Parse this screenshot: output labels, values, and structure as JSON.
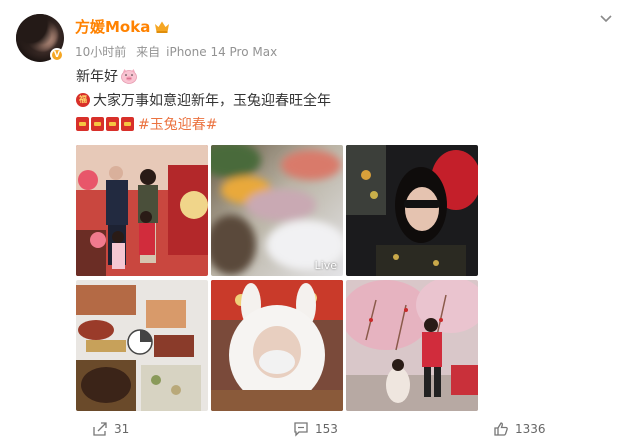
{
  "post": {
    "username": "方媛Moka",
    "time": "10小时前",
    "source_prefix": "来自",
    "source_device": "iPhone 14 Pro Max",
    "line1": "新年好",
    "line2": "大家万事如意迎新年，玉兔迎春旺全年",
    "hashtag": "#玉兔迎春#",
    "fu_char": "福",
    "images": [
      {
        "desc": "family-photo"
      },
      {
        "desc": "blurred-live",
        "badge": "Live"
      },
      {
        "desc": "car-selfie"
      },
      {
        "desc": "banquet-food"
      },
      {
        "desc": "bunny-hat-selfie"
      },
      {
        "desc": "pink-tree-decorations"
      }
    ]
  },
  "actions": {
    "share_count": "31",
    "comment_count": "153",
    "like_count": "1336"
  },
  "colors": {
    "username": "#ff8200",
    "hashtag": "#eb7340",
    "meta": "#939393"
  }
}
